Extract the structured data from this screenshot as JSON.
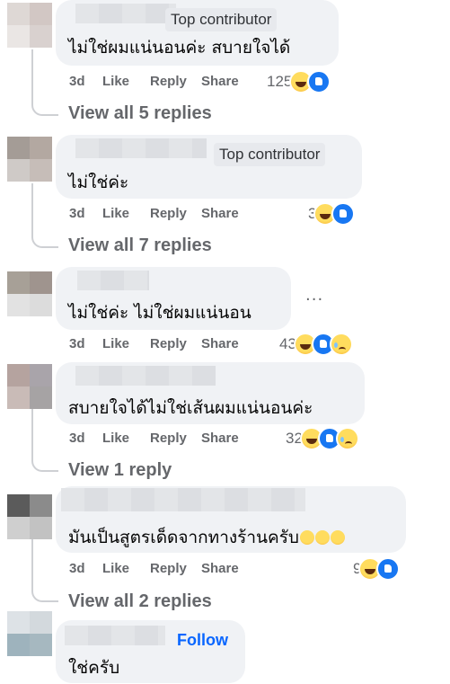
{
  "comments": [
    {
      "badge": "Top contributor",
      "text": "ไม่ใช่ผมแน่นอนค่ะ สบายใจได้",
      "time": "3d",
      "like": "Like",
      "reply": "Reply",
      "share": "Share",
      "reaction_count": "125",
      "reaction_icons": [
        "haha-icon",
        "like-icon"
      ],
      "view_replies": "View all 5 replies"
    },
    {
      "badge": "Top contributor",
      "text": "ไม่ใช่ค่ะ",
      "time": "3d",
      "like": "Like",
      "reply": "Reply",
      "share": "Share",
      "reaction_count": "3",
      "reaction_icons": [
        "haha-icon",
        "like-icon"
      ],
      "view_replies": "View all 7 replies"
    },
    {
      "text": "ไม่ใช่ค่ะ ไม่ใช่ผมแน่นอน",
      "more": "...",
      "time": "3d",
      "like": "Like",
      "reply": "Reply",
      "share": "Share",
      "reaction_count": "43",
      "reaction_icons": [
        "haha-icon",
        "like-icon",
        "sad-icon"
      ]
    },
    {
      "text": "สบายใจได้ไม่ใช่เส้นผมแน่นอนค่ะ",
      "time": "3d",
      "like": "Like",
      "reply": "Reply",
      "share": "Share",
      "reaction_count": "32",
      "reaction_icons": [
        "haha-icon",
        "like-icon",
        "sad-icon"
      ],
      "view_replies": "View 1 reply"
    },
    {
      "text": "มันเป็นสูตรเด็ดจากทางร้านครับ",
      "inline_emojis": [
        "rofl-emoji",
        "rofl-emoji",
        "rofl-emoji"
      ],
      "time": "3d",
      "like": "Like",
      "reply": "Reply",
      "share": "Share",
      "reaction_count": "9",
      "reaction_icons": [
        "haha-icon",
        "like-icon"
      ],
      "view_replies": "View all 2 replies"
    },
    {
      "follow": "Follow",
      "text": "ใช่ครับ"
    }
  ],
  "colors": {
    "bubble": "#f0f2f5",
    "meta_text": "#65676b",
    "follow_link": "#0866ff",
    "like_blue": "#1877f2"
  }
}
